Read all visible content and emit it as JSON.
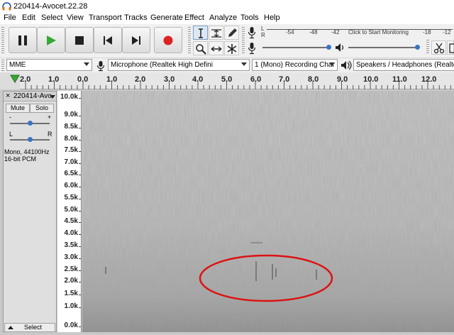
{
  "window": {
    "title": "220414-Avocet.22.28"
  },
  "menu": [
    "File",
    "Edit",
    "Select",
    "View",
    "Transport",
    "Tracks",
    "Generate",
    "Effect",
    "Analyze",
    "Tools",
    "Help"
  ],
  "meters": {
    "lr": [
      "L",
      "R"
    ],
    "ruler_labels": [
      "-54",
      "-48",
      "-42",
      "-18",
      "-12"
    ],
    "click_text": "Click to Start Monitoring"
  },
  "devices": {
    "host": "MME",
    "input": "Microphone (Realtek High Defini",
    "channels": "1 (Mono) Recording Char",
    "output": "Speakers / Headphones (Realtek"
  },
  "ruler": {
    "labels": [
      "2.0",
      "1.0",
      "0.0",
      "1.0",
      "2.0",
      "3.0",
      "4.0",
      "5.0",
      "6.0",
      "7.0",
      "8.0",
      "9.0",
      "10.0",
      "11.0",
      "12.0"
    ]
  },
  "track": {
    "name": "220414-Avo",
    "close": "×",
    "mute": "Mute",
    "solo": "Solo",
    "gain_minus": "-",
    "gain_plus": "+",
    "pan_left": "L",
    "pan_right": "R",
    "info_line1": "Mono, 44100Hz",
    "info_line2": "16-bit PCM",
    "select": "Select",
    "gain_level": 0.5,
    "pan_level": 0.5
  },
  "frequency_scale": [
    "10.0k",
    "9.0k",
    "8.5k",
    "8.0k",
    "7.5k",
    "7.0k",
    "6.5k",
    "6.0k",
    "5.5k",
    "5.0k",
    "4.5k",
    "4.0k",
    "3.5k",
    "3.0k",
    "2.5k",
    "2.0k",
    "1.5k",
    "1.0k",
    "0.0k"
  ],
  "colors": {
    "record": "#dd2222",
    "play": "#33aa33",
    "annotation": "#dd1111",
    "accent": "#3b73c4"
  }
}
